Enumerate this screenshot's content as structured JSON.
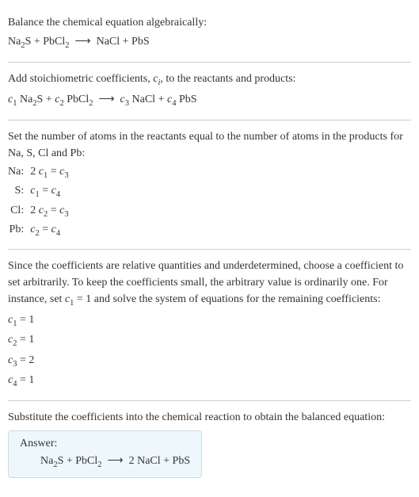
{
  "section1": {
    "intro": "Balance the chemical equation algebraically:"
  },
  "section2": {
    "intro": "Add stoichiometric coefficients, ",
    "intro2": ", to the reactants and products:"
  },
  "section3": {
    "intro": "Set the number of atoms in the reactants equal to the number of atoms in the products for Na, S, Cl and Pb:",
    "rows": [
      {
        "label": "Na:"
      },
      {
        "label": "S:"
      },
      {
        "label": "Cl:"
      },
      {
        "label": "Pb:"
      }
    ]
  },
  "section4": {
    "intro": "Since the coefficients are relative quantities and underdetermined, choose a coefficient to set arbitrarily. To keep the coefficients small, the arbitrary value is ordinarily one. For instance, set ",
    "intro2": " = 1 and solve the system of equations for the remaining coefficients:",
    "solns": [
      {
        "idx": "1",
        "val": " = 1"
      },
      {
        "idx": "2",
        "val": " = 1"
      },
      {
        "idx": "3",
        "val": " = 2"
      },
      {
        "idx": "4",
        "val": " = 1"
      }
    ]
  },
  "section5": {
    "intro": "Substitute the coefficients into the chemical reaction to obtain the balanced equation:"
  },
  "answer": {
    "title": "Answer:"
  },
  "chart_data": {
    "type": "table",
    "title": "Balance chemical equation",
    "reactants": [
      "Na2S",
      "PbCl2"
    ],
    "products": [
      "NaCl",
      "PbS"
    ],
    "elements": [
      "Na",
      "S",
      "Cl",
      "Pb"
    ],
    "atom_balance_equations": [
      {
        "element": "Na",
        "lhs": "2 c1",
        "rhs": "c3"
      },
      {
        "element": "S",
        "lhs": "c1",
        "rhs": "c4"
      },
      {
        "element": "Cl",
        "lhs": "2 c2",
        "rhs": "c3"
      },
      {
        "element": "Pb",
        "lhs": "c2",
        "rhs": "c4"
      }
    ],
    "arbitrary_set": "c1 = 1",
    "coefficients": {
      "c1": 1,
      "c2": 1,
      "c3": 2,
      "c4": 1
    },
    "balanced_equation": "Na2S + PbCl2 -> 2 NaCl + PbS"
  }
}
